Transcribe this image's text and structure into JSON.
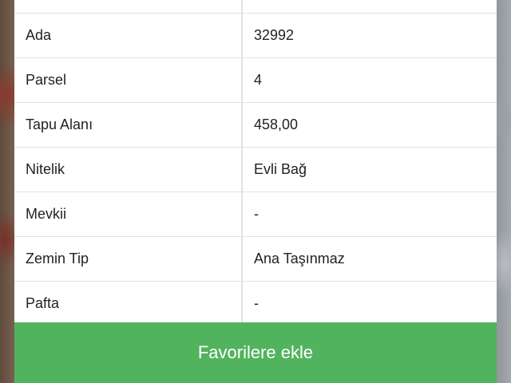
{
  "details": {
    "rows": [
      {
        "label": "",
        "value": ""
      },
      {
        "label": "Ada",
        "value": "32992"
      },
      {
        "label": "Parsel",
        "value": "4"
      },
      {
        "label": "Tapu Alanı",
        "value": "458,00"
      },
      {
        "label": "Nitelik",
        "value": "Evli Bağ"
      },
      {
        "label": "Mevkii",
        "value": "-"
      },
      {
        "label": "Zemin Tip",
        "value": "Ana Taşınmaz"
      },
      {
        "label": "Pafta",
        "value": "-"
      }
    ]
  },
  "actions": {
    "favorite_label": "Favorilere ekle"
  },
  "colors": {
    "button_bg": "#52b35f",
    "sheet_bg": "#ffffff",
    "divider": "#e2e2e2"
  }
}
